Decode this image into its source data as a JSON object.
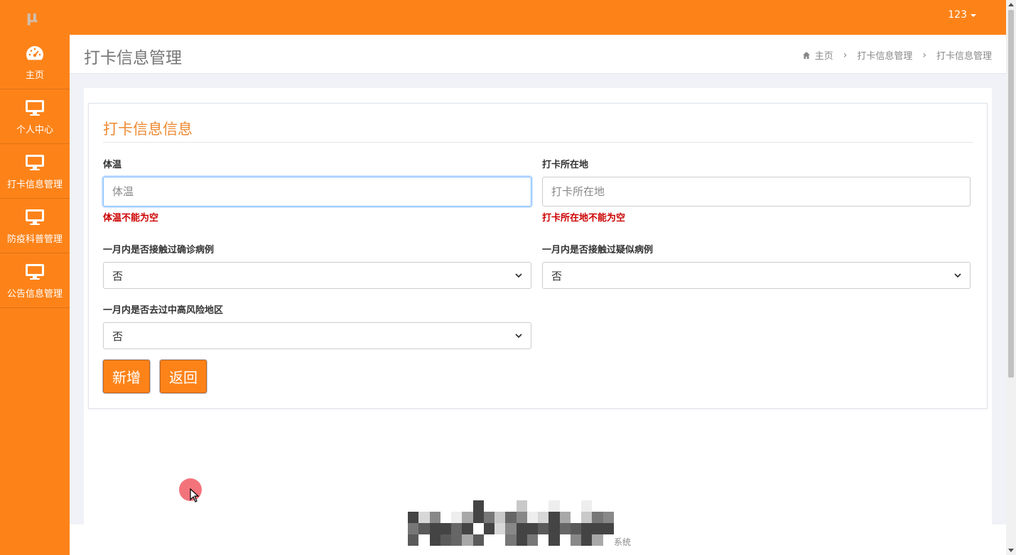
{
  "topbar": {
    "logo_text": "μ",
    "user_name": "123"
  },
  "sidebar": {
    "items": [
      {
        "label": "主页",
        "icon": "dashboard-icon"
      },
      {
        "label": "个人中心",
        "icon": "monitor-icon"
      },
      {
        "label": "打卡信息管理",
        "icon": "monitor-icon"
      },
      {
        "label": "防疫科普管理",
        "icon": "monitor-icon"
      },
      {
        "label": "公告信息管理",
        "icon": "monitor-icon"
      }
    ]
  },
  "header": {
    "title": "打卡信息管理",
    "breadcrumb": [
      "主页",
      "打卡信息管理",
      "打卡信息管理"
    ]
  },
  "form": {
    "title": "打卡信息信息",
    "temperature": {
      "label": "体温",
      "placeholder": "体温",
      "value": "",
      "error": "体温不能为空"
    },
    "location": {
      "label": "打卡所在地",
      "placeholder": "打卡所在地",
      "value": "",
      "error": "打卡所在地不能为空"
    },
    "confirmed_contact": {
      "label": "一月内是否接触过确诊病例",
      "selected": "否"
    },
    "suspected_contact": {
      "label": "一月内是否接触过疑似病例",
      "selected": "否"
    },
    "risk_area": {
      "label": "一月内是否去过中高风险地区",
      "selected": "否"
    },
    "submit_label": "新增",
    "back_label": "返回"
  },
  "footer": {
    "text": "系统"
  },
  "colors": {
    "accent": "#fd8319",
    "error": "#cc0000",
    "title": "#ee8a32"
  }
}
